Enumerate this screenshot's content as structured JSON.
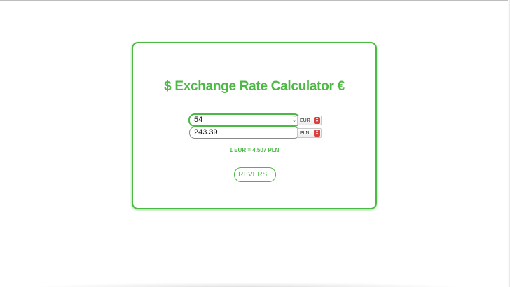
{
  "calculator": {
    "title": "$ Exchange Rate Calculator €",
    "from": {
      "amount": "54",
      "currency": "EUR"
    },
    "to": {
      "amount": "243.39",
      "currency": "PLN"
    },
    "rate_text": "1 EUR = 4.507 PLN",
    "reverse_label": "REVERSE"
  },
  "colors": {
    "accent": "#4cb944",
    "select_arrow": "#d9423c"
  }
}
